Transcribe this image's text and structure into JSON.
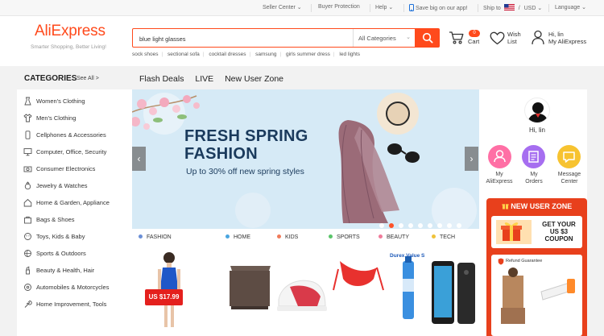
{
  "topbar": {
    "seller_center": "Seller Center",
    "buyer_protection": "Buyer Protection",
    "help": "Help",
    "app_promo": "Save big on our app!",
    "ship_to": "Ship to",
    "currency_sep": "/",
    "currency": "USD",
    "language": "Language"
  },
  "header": {
    "logo": "AliExpress",
    "tagline": "Smarter Shopping, Better Living!",
    "search_value": "blue light glasses",
    "search_category": "All Categories",
    "hot_searches": [
      "sock shoes",
      "sectional sofa",
      "cocktail dresses",
      "samsung",
      "girls summer dress",
      "led lights"
    ],
    "cart_count": "0",
    "cart_label": "Cart",
    "wish_label_1": "Wish",
    "wish_label_2": "List",
    "account_greeting": "Hi, lin",
    "account_link": "My AliExpress"
  },
  "categories": {
    "title": "CATEGORIES",
    "see_all": "See All >",
    "items": [
      "Women's Clothing",
      "Men's Clothing",
      "Cellphones & Accessories",
      "Computer, Office, Security",
      "Consumer Electronics",
      "Jewelry & Watches",
      "Home & Garden, Appliance",
      "Bags & Shoes",
      "Toys, Kids & Baby",
      "Sports & Outdoors",
      "Beauty & Health, Hair",
      "Automobiles & Motorcycles",
      "Home Improvement, Tools"
    ]
  },
  "nav": {
    "tabs": [
      "Flash Deals",
      "LIVE",
      "New User Zone"
    ]
  },
  "banner": {
    "headline_1": "FRESH SPRING",
    "headline_2": "FASHION",
    "subline": "Up to 30% off new spring styles",
    "prev": "‹",
    "next": "›"
  },
  "category_row": [
    {
      "label": "FASHION",
      "color": "#6b8fd6"
    },
    {
      "label": "HOME",
      "color": "#4aa6e0"
    },
    {
      "label": "KIDS",
      "color": "#f07b5a"
    },
    {
      "label": "SPORTS",
      "color": "#5ac46a"
    },
    {
      "label": "BEAUTY",
      "color": "#f07b9a"
    },
    {
      "label": "TECH",
      "color": "#f0c23a"
    }
  ],
  "products": {
    "price_tag": "US $17.99",
    "brand_text": "Durex Value S"
  },
  "user_panel": {
    "greeting": "Hi, lin",
    "quick_links": [
      {
        "line1": "My",
        "line2": "AliExpress",
        "color": "#ff6fa5"
      },
      {
        "line1": "My",
        "line2": "Orders",
        "color": "#a66ef0"
      },
      {
        "line1": "Message",
        "line2": "Center",
        "color": "#f7c330"
      }
    ],
    "new_user_zone": "NEW USER ZONE",
    "coupon_line_1": "GET YOUR",
    "coupon_line_2": "US $3",
    "coupon_line_3": "COUPON",
    "refund": "Refund Guarantee"
  }
}
